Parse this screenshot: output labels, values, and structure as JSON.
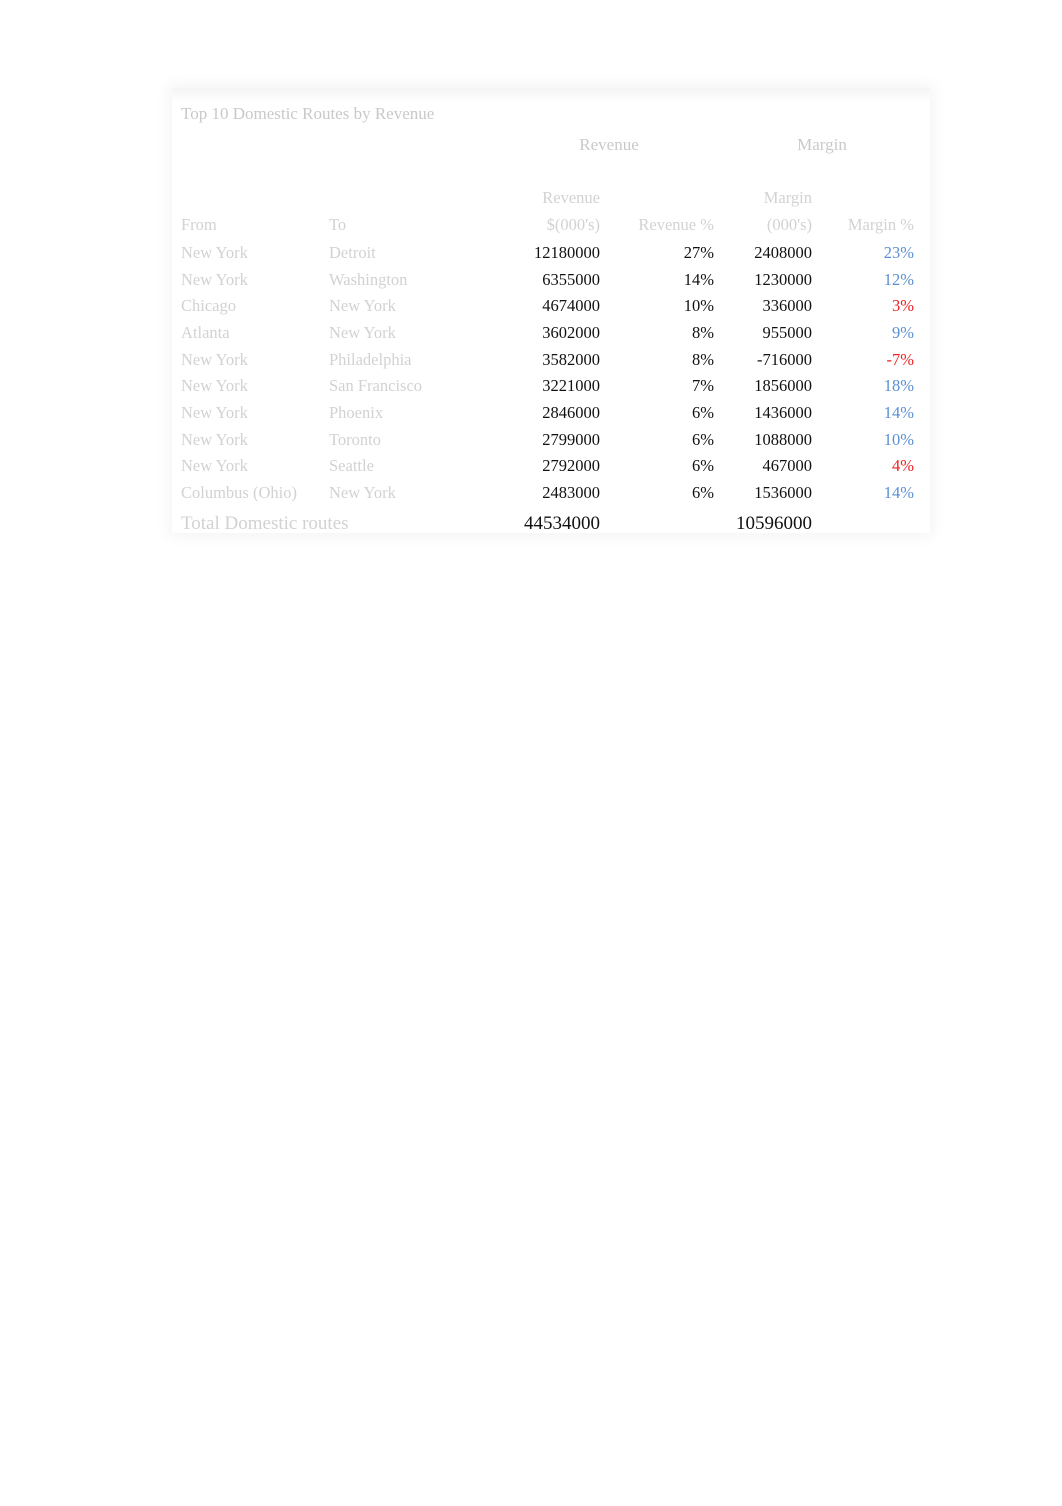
{
  "report": {
    "title": "Top 10 Domestic Routes by Revenue",
    "group_headers": {
      "revenue": "Revenue",
      "margin": "Margin"
    },
    "columns": {
      "from": "From",
      "to": "To",
      "revenue_amount_line1": "Revenue",
      "revenue_amount_line2": "$(000's)",
      "revenue_percent": "Revenue %",
      "margin_amount_line1": "Margin",
      "margin_amount_line2": "(000's)",
      "margin_percent": "Margin %"
    },
    "colors": {
      "positive": "#5b8fd4",
      "negative": "#ee2222",
      "value": "#111111",
      "label": "#d2d2d2",
      "title": "#c9c9c9"
    },
    "rows": [
      {
        "from": "New York",
        "to": "Detroit",
        "revenue": "12180000",
        "revenue_pct": "27%",
        "margin": "2408000",
        "margin_pct": "23%",
        "margin_sign": "positive"
      },
      {
        "from": "New York",
        "to": "Washington",
        "revenue": "6355000",
        "revenue_pct": "14%",
        "margin": "1230000",
        "margin_pct": "12%",
        "margin_sign": "positive"
      },
      {
        "from": "Chicago",
        "to": "New York",
        "revenue": "4674000",
        "revenue_pct": "10%",
        "margin": "336000",
        "margin_pct": "3%",
        "margin_sign": "negative"
      },
      {
        "from": "Atlanta",
        "to": "New York",
        "revenue": "3602000",
        "revenue_pct": "8%",
        "margin": "955000",
        "margin_pct": "9%",
        "margin_sign": "positive"
      },
      {
        "from": "New York",
        "to": "Philadelphia",
        "revenue": "3582000",
        "revenue_pct": "8%",
        "margin": "-716000",
        "margin_pct": "-7%",
        "margin_sign": "negative"
      },
      {
        "from": "New York",
        "to": "San Francisco",
        "revenue": "3221000",
        "revenue_pct": "7%",
        "margin": "1856000",
        "margin_pct": "18%",
        "margin_sign": "positive"
      },
      {
        "from": "New York",
        "to": "Phoenix",
        "revenue": "2846000",
        "revenue_pct": "6%",
        "margin": "1436000",
        "margin_pct": "14%",
        "margin_sign": "positive"
      },
      {
        "from": "New York",
        "to": "Toronto",
        "revenue": "2799000",
        "revenue_pct": "6%",
        "margin": "1088000",
        "margin_pct": "10%",
        "margin_sign": "positive"
      },
      {
        "from": "New York",
        "to": "Seattle",
        "revenue": "2792000",
        "revenue_pct": "6%",
        "margin": "467000",
        "margin_pct": "4%",
        "margin_sign": "negative"
      },
      {
        "from": "Columbus (Ohio)",
        "to": "New York",
        "revenue": "2483000",
        "revenue_pct": "6%",
        "margin": "1536000",
        "margin_pct": "14%",
        "margin_sign": "positive"
      }
    ],
    "total": {
      "label": "Total Domestic routes",
      "revenue": "44534000",
      "revenue_pct": "",
      "margin": "10596000",
      "margin_pct": ""
    }
  }
}
